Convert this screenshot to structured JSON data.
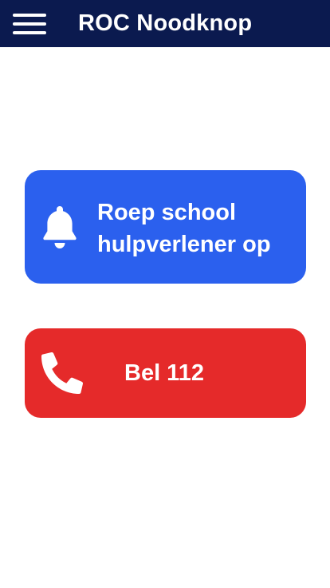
{
  "header": {
    "title": "ROC Noodknop",
    "menu_icon": "hamburger-menu-icon",
    "background_color": "#0b1a4f"
  },
  "actions": {
    "call_school": {
      "label": "Roep school hulpverlener op",
      "icon": "bell-icon",
      "color": "#2b60ee"
    },
    "call_112": {
      "label": "Bel 112",
      "icon": "phone-icon",
      "color": "#e52a2a"
    }
  }
}
